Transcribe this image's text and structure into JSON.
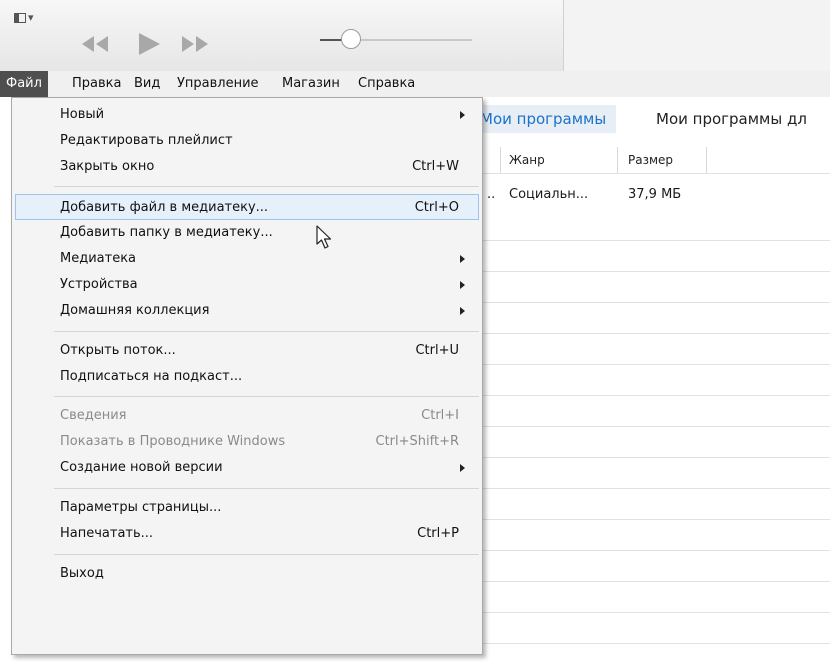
{
  "toolbar": {
    "icons": [
      "sidebar-toggle-icon",
      "rewind-icon",
      "play-icon",
      "fast-forward-icon",
      "volume-slider"
    ],
    "volume_level": 0.2
  },
  "menubar": {
    "items": [
      {
        "label": "Файл"
      },
      {
        "label": "Правка"
      },
      {
        "label": "Вид"
      },
      {
        "label": "Управление"
      },
      {
        "label": "Магазин"
      },
      {
        "label": "Справка"
      }
    ]
  },
  "tabs": {
    "active": "Мои программы",
    "other": "Мои программы дл"
  },
  "table": {
    "columns": [
      "Жанр",
      "Размер"
    ],
    "rows": [
      {
        "prefix": "..",
        "genre": "Социальн...",
        "size": "37,9 МБ"
      }
    ]
  },
  "file_menu": {
    "items": [
      {
        "label": "Новый",
        "shortcut": "",
        "submenu": true
      },
      {
        "label": "Редактировать плейлист",
        "shortcut": ""
      },
      {
        "label": "Закрыть окно",
        "shortcut": "Ctrl+W"
      },
      {
        "label": "Добавить файл в медиатеку...",
        "shortcut": "Ctrl+O",
        "highlighted": true
      },
      {
        "label": "Добавить папку в медиатеку...",
        "shortcut": ""
      },
      {
        "label": "Медиатека",
        "shortcut": "",
        "submenu": true
      },
      {
        "label": "Устройства",
        "shortcut": "",
        "submenu": true
      },
      {
        "label": "Домашняя коллекция",
        "shortcut": "",
        "submenu": true
      },
      {
        "label": "Открыть поток...",
        "shortcut": "Ctrl+U"
      },
      {
        "label": "Подписаться на подкаст...",
        "shortcut": ""
      },
      {
        "label": "Сведения",
        "shortcut": "Ctrl+I",
        "disabled": true
      },
      {
        "label": "Показать в Проводнике Windows",
        "shortcut": "Ctrl+Shift+R",
        "disabled": true
      },
      {
        "label": "Создание новой версии",
        "shortcut": "",
        "submenu": true
      },
      {
        "label": "Параметры страницы...",
        "shortcut": ""
      },
      {
        "label": "Напечатать...",
        "shortcut": "Ctrl+P"
      },
      {
        "label": "Выход",
        "shortcut": ""
      }
    ]
  },
  "colors": {
    "highlight_bg": "#e6f0fb",
    "highlight_border": "#9dc4ec",
    "accent": "#1a73c9",
    "menubar_open": "#4f4f4f"
  }
}
